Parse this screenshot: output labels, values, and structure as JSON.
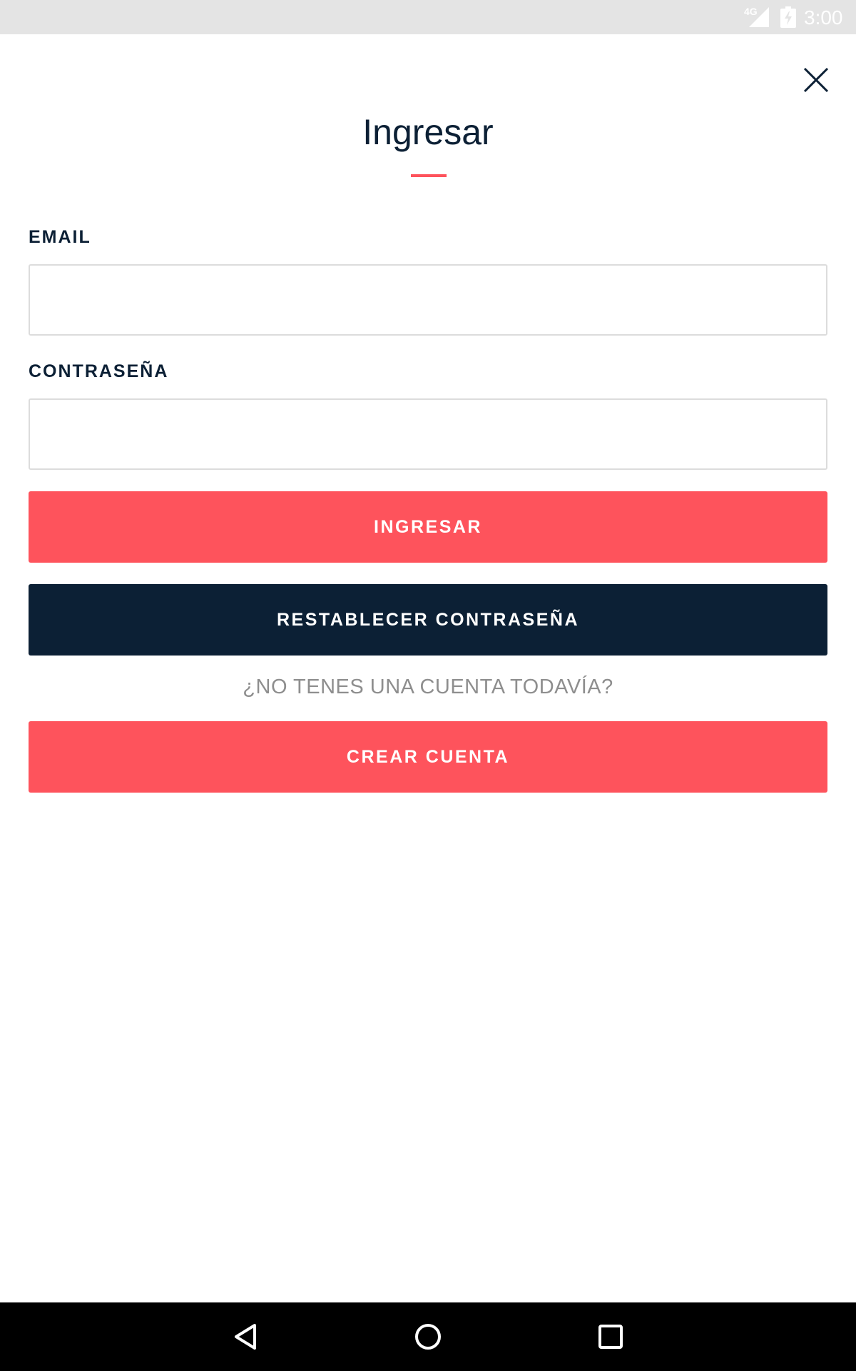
{
  "status_bar": {
    "network": "4G",
    "time": "3:00"
  },
  "header": {
    "title": "Ingresar",
    "close_icon": "close-icon",
    "accent_color": "#fe535c"
  },
  "form": {
    "email_label": "EMAIL",
    "email_value": "",
    "password_label": "CONTRASEÑA",
    "password_value": "",
    "login_button": "INGRESAR",
    "reset_button": "RESTABLECER CONTRASEÑA",
    "no_account_prompt": "¿NO TENES UNA CUENTA TODAVÍA?",
    "create_account_button": "CREAR CUENTA"
  },
  "colors": {
    "primary": "#fe535c",
    "dark": "#0c2035",
    "muted_text": "#8e8e8e"
  },
  "nav_bar": {
    "icons": [
      "back-icon",
      "home-icon",
      "recents-icon"
    ]
  }
}
